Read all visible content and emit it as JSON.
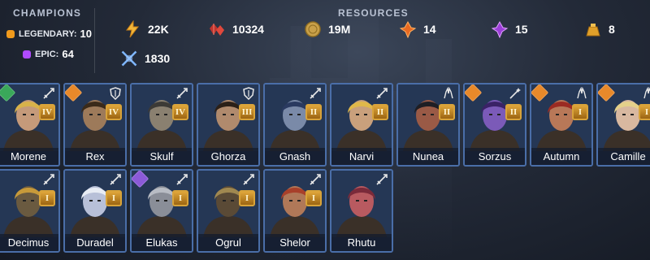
{
  "champions_panel": {
    "title": "CHAMPIONS",
    "legendary": {
      "label": "LEGENDARY:",
      "count": "10",
      "color": "#f09a1c"
    },
    "epic": {
      "label": "EPIC:",
      "count": "64",
      "color": "#b04bff"
    }
  },
  "resources_panel": {
    "title": "RESOURCES",
    "items": [
      {
        "icon": "lightning-energy-icon",
        "value": "22K"
      },
      {
        "icon": "red-ruby-gems-icon",
        "value": "10324"
      },
      {
        "icon": "gold-coin-icon",
        "value": "19M"
      },
      {
        "icon": "orange-shard-icon",
        "value": "14"
      },
      {
        "icon": "purple-shard-icon",
        "value": "15"
      },
      {
        "icon": "gold-bag-icon",
        "value": "8"
      },
      {
        "icon": "crossed-swords-arena-icon",
        "value": "1830"
      }
    ]
  },
  "champions": [
    {
      "name": "Morene",
      "rank": "IV",
      "role": "attack",
      "affinity": "green",
      "skin": "#c59a7a",
      "hair": "#d8b24a"
    },
    {
      "name": "Rex",
      "rank": "IV",
      "role": "defense",
      "affinity": "orange",
      "skin": "#9d7a5a",
      "hair": "#3a2a1a"
    },
    {
      "name": "Skulf",
      "rank": "IV",
      "role": "attack",
      "affinity": "",
      "skin": "#8a8070",
      "hair": "#3c3a36"
    },
    {
      "name": "Ghorza",
      "rank": "III",
      "role": "defense",
      "affinity": "",
      "skin": "#b08a6d",
      "hair": "#2b2018"
    },
    {
      "name": "Gnash",
      "rank": "II",
      "role": "attack",
      "affinity": "",
      "skin": "#7a8aa8",
      "hair": "#2a3a60"
    },
    {
      "name": "Narvi",
      "rank": "II",
      "role": "attack",
      "affinity": "",
      "skin": "#c9a07c",
      "hair": "#e0b84a"
    },
    {
      "name": "Nunea",
      "rank": "II",
      "role": "support",
      "affinity": "",
      "skin": "#9a5a46",
      "hair": "#1e1e24"
    },
    {
      "name": "Sorzus",
      "rank": "II",
      "role": "magic",
      "affinity": "orange",
      "skin": "#7b5ab8",
      "hair": "#3a2266"
    },
    {
      "name": "Autumn",
      "rank": "I",
      "role": "support",
      "affinity": "orange",
      "skin": "#b87858",
      "hair": "#9b2b22"
    },
    {
      "name": "Camille",
      "rank": "I",
      "role": "support",
      "affinity": "orange",
      "skin": "#d8b8a0",
      "hair": "#e4d08a"
    },
    {
      "name": "Decimus",
      "rank": "I",
      "role": "attack",
      "affinity": "",
      "skin": "#6a5a40",
      "hair": "#c79a3a"
    },
    {
      "name": "Duradel",
      "rank": "I",
      "role": "attack",
      "affinity": "",
      "skin": "#b8c0d8",
      "hair": "#e8ecf4"
    },
    {
      "name": "Elukas",
      "rank": "I",
      "role": "attack",
      "affinity": "purple",
      "skin": "#8a8e98",
      "hair": "#b8bcc4"
    },
    {
      "name": "Ogrul",
      "rank": "I",
      "role": "attack",
      "affinity": "",
      "skin": "#5a4a36",
      "hair": "#a08850"
    },
    {
      "name": "Shelor",
      "rank": "I",
      "role": "attack",
      "affinity": "",
      "skin": "#b07858",
      "hair": "#a8402a"
    },
    {
      "name": "Rhutu",
      "rank": "",
      "role": "attack",
      "affinity": "",
      "skin": "#b85a60",
      "hair": "#7a2a3a"
    }
  ]
}
